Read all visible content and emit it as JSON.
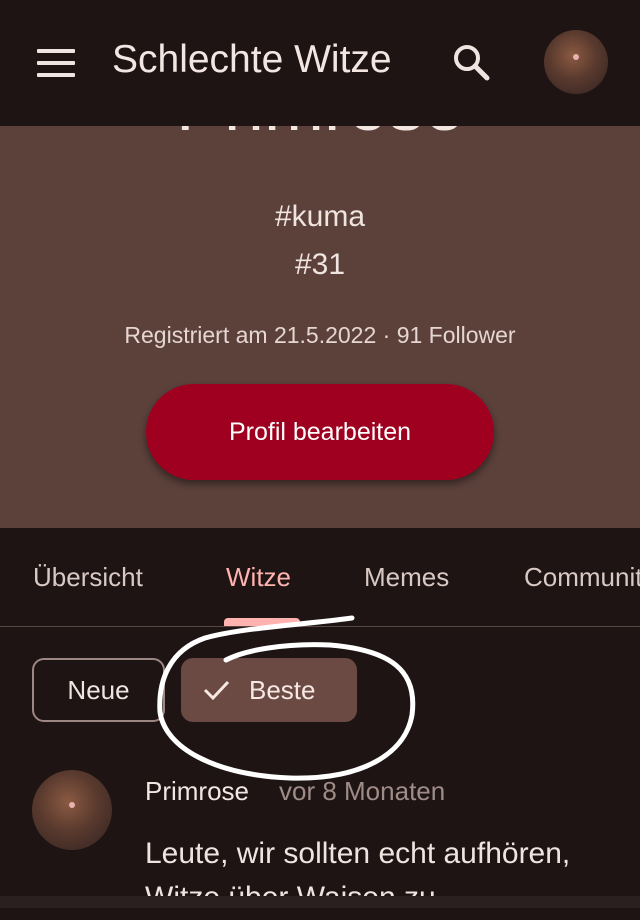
{
  "app": {
    "title": "Schlechte Witze"
  },
  "profile": {
    "name": "Primrose",
    "handle1": "#kuma",
    "handle2": "#31",
    "meta": "Registriert am 21.5.2022 · 91 Follower",
    "edit_button": "Profil bearbeiten"
  },
  "tabs": [
    {
      "label": "Übersicht",
      "active": false
    },
    {
      "label": "Witze",
      "active": true
    },
    {
      "label": "Memes",
      "active": false
    },
    {
      "label": "Community",
      "active": false
    }
  ],
  "filters": {
    "neue": "Neue",
    "beste": "Beste",
    "selected": "Beste"
  },
  "post": {
    "author": "Primrose",
    "time": "vor 8 Monaten",
    "text": "Leute, wir sollten echt aufhören, Witze über Waisen zu"
  },
  "colors": {
    "background": "#1e1414",
    "header": "#5c413b",
    "accent": "#ffb2ae",
    "button": "#a0001f"
  },
  "icons": [
    "menu-icon",
    "search-icon",
    "check-icon"
  ]
}
